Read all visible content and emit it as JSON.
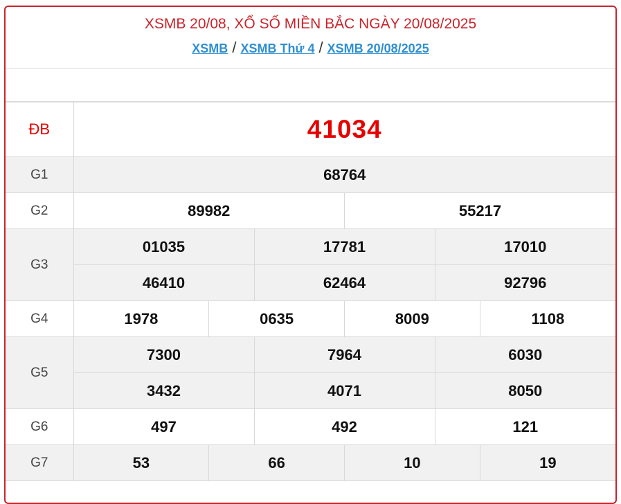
{
  "header": {
    "title": "XSMB 20/08, XỔ SỐ MIỀN BẮC NGÀY 20/08/2025",
    "breadcrumbs": [
      "XSMB",
      "XSMB Thứ 4",
      "XSMB 20/08/2025"
    ],
    "separator": "/"
  },
  "results": {
    "db": {
      "label": "ĐB",
      "values": [
        "41034"
      ]
    },
    "g1": {
      "label": "G1",
      "values": [
        "68764"
      ]
    },
    "g2": {
      "label": "G2",
      "values": [
        "89982",
        "55217"
      ]
    },
    "g3": {
      "label": "G3",
      "values": [
        "01035",
        "17781",
        "17010",
        "46410",
        "62464",
        "92796"
      ]
    },
    "g4": {
      "label": "G4",
      "values": [
        "1978",
        "0635",
        "8009",
        "1108"
      ]
    },
    "g5": {
      "label": "G5",
      "values": [
        "7300",
        "7964",
        "6030",
        "3432",
        "4071",
        "8050"
      ]
    },
    "g6": {
      "label": "G6",
      "values": [
        "497",
        "492",
        "121"
      ]
    },
    "g7": {
      "label": "G7",
      "values": [
        "53",
        "66",
        "10",
        "19"
      ]
    }
  },
  "colors": {
    "accent": "#c9242b",
    "special_prize": "#e60000",
    "link": "#2f8fd1",
    "row_alt": "#f1f1f1"
  }
}
